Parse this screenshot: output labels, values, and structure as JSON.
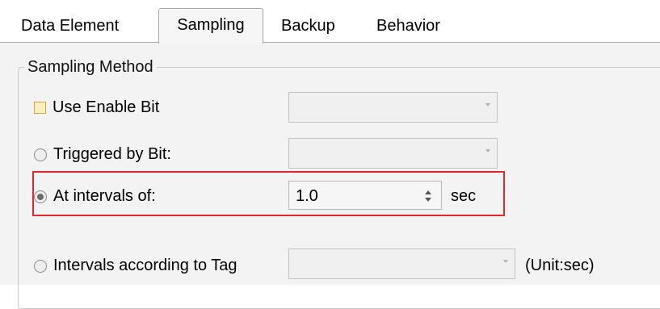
{
  "tabs": [
    {
      "label": "Data Element",
      "active": false
    },
    {
      "label": "Sampling",
      "active": true
    },
    {
      "label": "Backup",
      "active": false
    },
    {
      "label": "Behavior",
      "active": false
    }
  ],
  "sampling_method": {
    "group_title": "Sampling Method",
    "use_enable_bit": {
      "label": "Use Enable Bit",
      "checked": false,
      "combo_value": ""
    },
    "triggered_by_bit": {
      "label": "Triggered by Bit:",
      "selected": false,
      "combo_value": ""
    },
    "at_intervals": {
      "label": "At intervals of:",
      "selected": true,
      "value": "1.0",
      "unit": "sec"
    },
    "intervals_by_tag": {
      "label": "Intervals according to Tag",
      "selected": false,
      "combo_value": "",
      "unit": "(Unit:sec)"
    }
  },
  "colors": {
    "highlight": "#e8252a",
    "panel_bg": "#f3f3f3",
    "checkbox_fill": "#fdefbe"
  }
}
